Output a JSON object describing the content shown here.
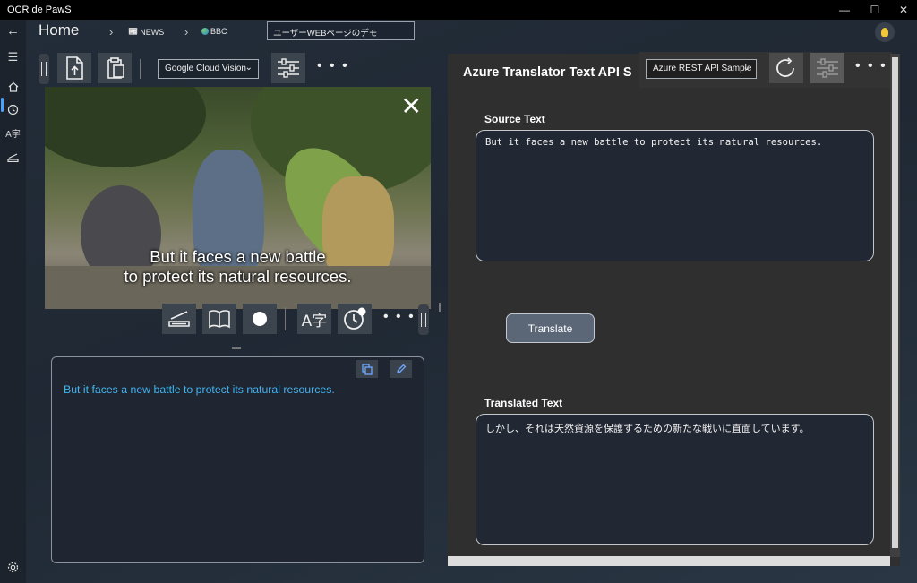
{
  "window": {
    "title": "OCR de PawS"
  },
  "header": {
    "home": "Home",
    "breadcrumbs": [
      {
        "icon": "newspaper-icon",
        "label": "NEWS"
      },
      {
        "icon": "globe-icon",
        "label": "BBC"
      }
    ],
    "page_title_box": "ユーザーWEBページのデモ"
  },
  "left_toolbar": {
    "ocr_engine": "Google Cloud Vision",
    "more": "• • •"
  },
  "image": {
    "caption_line1": "But it faces a new battle",
    "caption_line2": "to protect its natural resources."
  },
  "image_toolbar": {
    "more": "• • •"
  },
  "ocr_result": {
    "text": "But it faces a new battle to protect its natural resources."
  },
  "right_panel": {
    "title": "Azure Translator Text API S",
    "mode": "Azure REST API Sample",
    "more": "• • •",
    "source_label": "Source Text",
    "source_text": "But it faces a new battle to protect its natural resources.",
    "translate_button": "Translate",
    "translated_label": "Translated Text",
    "translated_text": "しかし、それは天然資源を保護するための新たな戦いに直面しています。"
  },
  "colors": {
    "ocr_text": "#41b4f0",
    "accent_nav": "#4aa3ff",
    "bulb": "#f3c63a"
  }
}
